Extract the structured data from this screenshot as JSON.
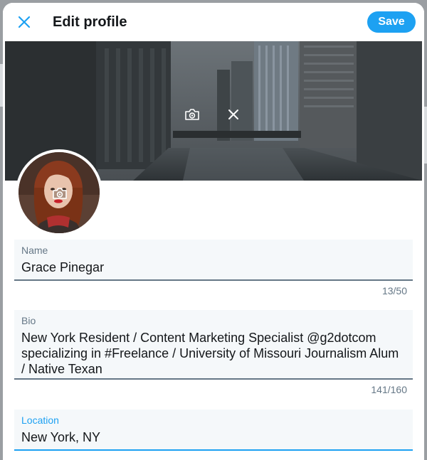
{
  "header": {
    "title": "Edit profile",
    "save_label": "Save"
  },
  "fields": {
    "name": {
      "label": "Name",
      "value": "Grace Pinegar",
      "counter": "13/50"
    },
    "bio": {
      "label": "Bio",
      "value": "New York Resident / Content Marketing Specialist @g2dotcom specializing in #Freelance / University of Missouri Journalism Alum / Native Texan",
      "counter": "141/160"
    },
    "location": {
      "label": "Location",
      "value": "New York, NY"
    }
  },
  "icons": {
    "close": "close-icon",
    "banner_camera": "camera-icon",
    "banner_remove": "remove-icon",
    "avatar_camera": "camera-icon"
  },
  "colors": {
    "accent": "#1da1f2",
    "text": "#14171a",
    "muted": "#657786",
    "field_bg": "#f5f8fa"
  }
}
